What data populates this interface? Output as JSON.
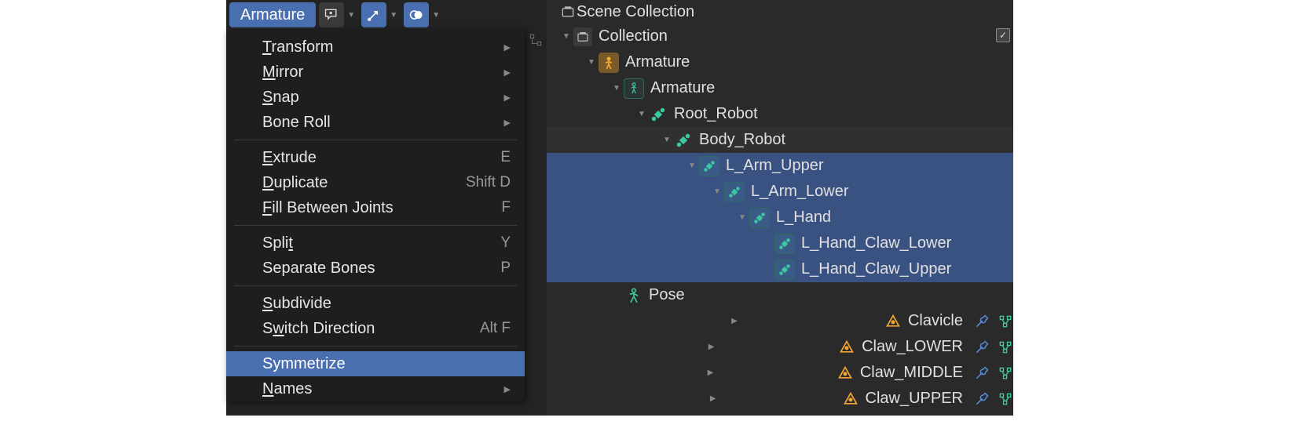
{
  "header": {
    "menu_button": "Armature"
  },
  "menu": {
    "items": [
      {
        "label": "Transform",
        "u": 0,
        "submenu": true
      },
      {
        "label": "Mirror",
        "u": 0,
        "submenu": true
      },
      {
        "label": "Snap",
        "u": 0,
        "submenu": true
      },
      {
        "label": "Bone Roll",
        "submenu": true
      },
      {
        "sep": true
      },
      {
        "label": "Extrude",
        "u": 0,
        "shortcut": "E"
      },
      {
        "label": "Duplicate",
        "u": 0,
        "shortcut": "Shift D"
      },
      {
        "label": "Fill Between Joints",
        "u": 0,
        "shortcut": "F"
      },
      {
        "sep": true
      },
      {
        "label": "Split",
        "u": 4,
        "shortcut": "Y"
      },
      {
        "label": "Separate Bones",
        "shortcut": "P"
      },
      {
        "sep": true
      },
      {
        "label": "Subdivide",
        "u": 0
      },
      {
        "label": "Switch Direction",
        "u": 1,
        "shortcut": "Alt F"
      },
      {
        "sep": true
      },
      {
        "label": "Symmetrize",
        "highlighted": true
      },
      {
        "label": "Names",
        "u": 0,
        "submenu": true
      }
    ]
  },
  "outliner": {
    "root": "Scene Collection",
    "collection": "Collection",
    "armature_obj": "Armature",
    "armature_data": "Armature",
    "bones": {
      "root": "Root_Robot",
      "body": "Body_Robot",
      "arm_upper": "L_Arm_Upper",
      "arm_lower": "L_Arm_Lower",
      "hand": "L_Hand",
      "claw_lower": "L_Hand_Claw_Lower",
      "claw_upper": "L_Hand_Claw_Upper"
    },
    "pose": "Pose",
    "vgroups": {
      "clavicle": "Clavicle",
      "claw_l": "Claw_LOWER",
      "claw_m": "Claw_MIDDLE",
      "claw_u": "Claw_UPPER"
    }
  }
}
